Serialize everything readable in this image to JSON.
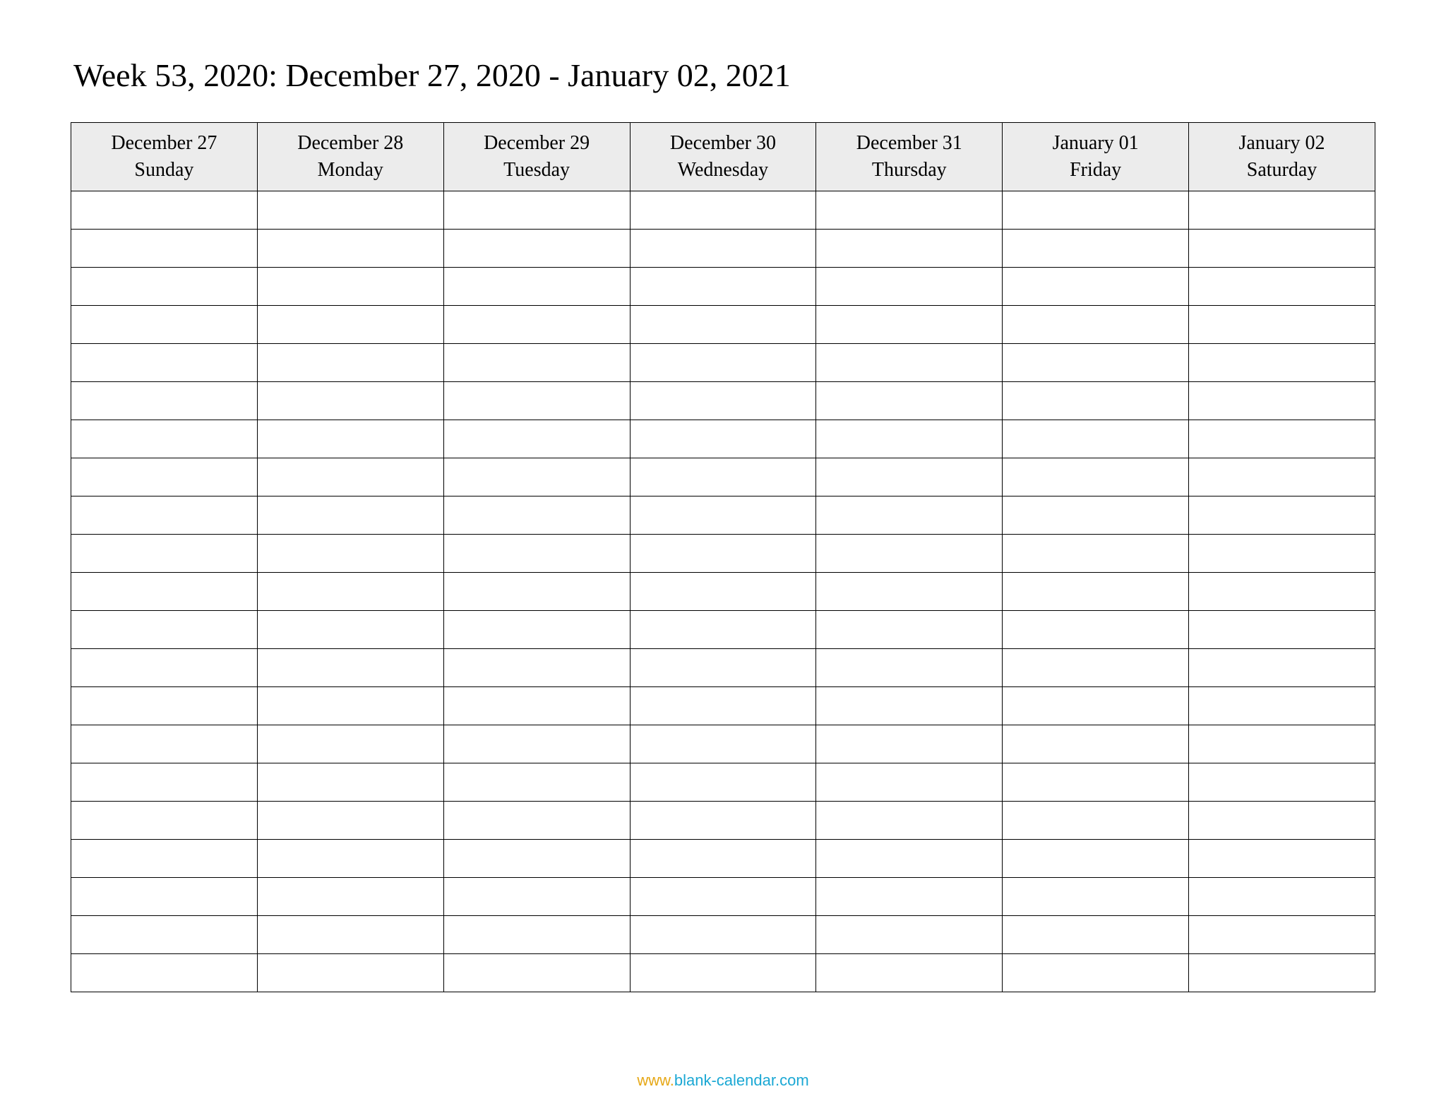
{
  "title": "Week 53, 2020: December 27, 2020 - January 02, 2021",
  "columns": [
    {
      "date": "December 27",
      "day": "Sunday"
    },
    {
      "date": "December 28",
      "day": "Monday"
    },
    {
      "date": "December 29",
      "day": "Tuesday"
    },
    {
      "date": "December 30",
      "day": "Wednesday"
    },
    {
      "date": "December 31",
      "day": "Thursday"
    },
    {
      "date": "January 01",
      "day": "Friday"
    },
    {
      "date": "January 02",
      "day": "Saturday"
    }
  ],
  "row_count": 21,
  "footer": {
    "www": "www.",
    "domain": "blank-calendar.com"
  }
}
